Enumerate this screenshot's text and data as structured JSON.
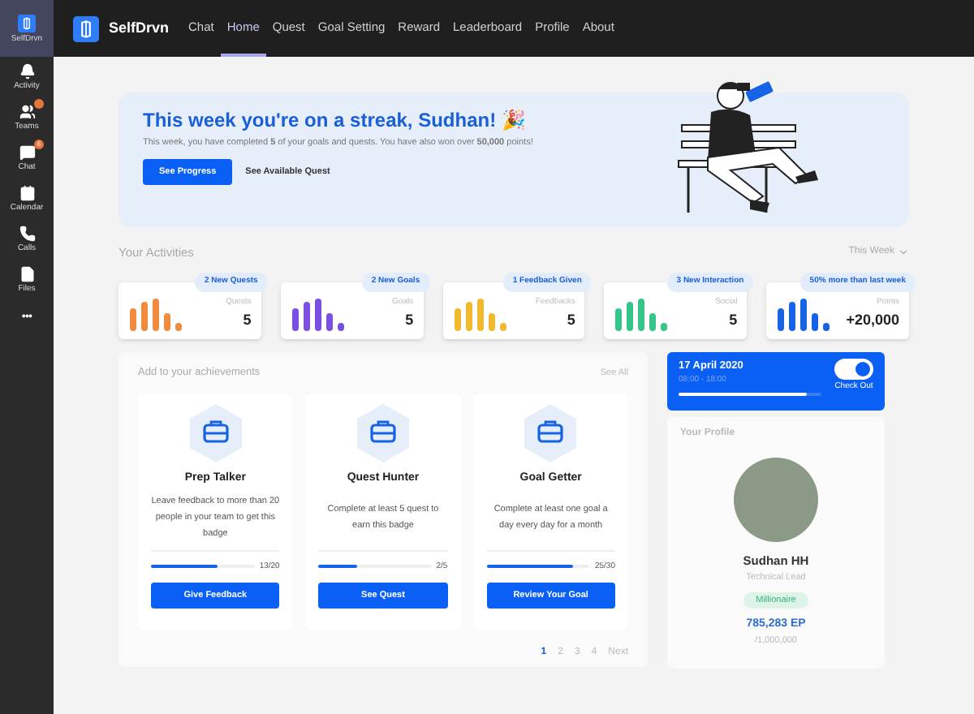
{
  "rail": {
    "items": [
      {
        "label": "SelfDrvn",
        "kind": "app",
        "selected": true
      },
      {
        "label": "Activity",
        "kind": "bell",
        "selected": false
      },
      {
        "label": "Teams",
        "kind": "teams",
        "selected": false,
        "badge": true
      },
      {
        "label": "Chat",
        "kind": "chat",
        "selected": false,
        "badge": true,
        "count": "6"
      },
      {
        "label": "Calendar",
        "kind": "calendar",
        "selected": false
      },
      {
        "label": "Calls",
        "kind": "phone",
        "selected": false
      },
      {
        "label": "Files",
        "kind": "file",
        "selected": false
      }
    ],
    "more": "•••"
  },
  "header": {
    "app_name": "SelfDrvn",
    "tabs": [
      {
        "label": "Chat",
        "selected": false
      },
      {
        "label": "Home",
        "selected": true
      },
      {
        "label": "Quest",
        "selected": false
      },
      {
        "label": "Goal Setting",
        "selected": false
      },
      {
        "label": "Reward",
        "selected": false
      },
      {
        "label": "Leaderboard",
        "selected": false
      },
      {
        "label": "Profile",
        "selected": false
      },
      {
        "label": "About",
        "selected": false
      }
    ]
  },
  "banner": {
    "title": "This week you're on a streak, Sudhan! 🎉",
    "text": "This week, you have completed **5** of your goals and quests. You have also won over **50,000** points!",
    "primary_button": "See Progress",
    "secondary_button": "See Available Quest"
  },
  "activities": {
    "title": "Your Activities",
    "period": "This Week",
    "cards": [
      {
        "tag": "2 New Quests",
        "label": "Quests",
        "value": "5",
        "color": "#f08a3c"
      },
      {
        "tag": "2 New Goals",
        "label": "Goals",
        "value": "5",
        "color": "#7b4fe0"
      },
      {
        "tag": "1 Feedback Given",
        "label": "Feedbacks",
        "value": "5",
        "color": "#f2b92f"
      },
      {
        "tag": "3 New Interaction",
        "label": "Social",
        "value": "5",
        "color": "#35c48a"
      },
      {
        "tag": "50% more than last week",
        "label": "Points",
        "value": "+20,000",
        "color": "#1663e6"
      }
    ]
  },
  "achievements": {
    "title": "Add to your achievements",
    "see_all": "See All",
    "badges": [
      {
        "title": "Prep Talker",
        "text": "Leave feedback to more than 20 people in your team to get this badge",
        "level": 0.65,
        "reading": "13/20",
        "button": "Give Feedback"
      },
      {
        "title": "Quest Hunter",
        "text": "Complete at least 5 quest to earn this badge",
        "level": 0.34,
        "reading": "2/5",
        "button": "See Quest"
      },
      {
        "title": "Goal Getter",
        "text": "Complete at least one goal a day every day for a month",
        "level": 0.83,
        "reading": "25/30",
        "button": "Review Your Goal"
      }
    ],
    "pages": [
      {
        "label": "1",
        "selected": true
      },
      {
        "label": "2",
        "selected": false
      },
      {
        "label": "3",
        "selected": false
      },
      {
        "label": "4",
        "selected": false
      }
    ],
    "next": "Next"
  },
  "checkin": {
    "date": "17 April 2020",
    "hours": "08:00 - 18:00",
    "level": 0.9,
    "on": true,
    "toggle_label": "Check Out"
  },
  "profile": {
    "title": "Your Profile",
    "name": "Sudhan HH",
    "role": "Technical Lead",
    "badge": "Millionaire",
    "points": "785,283 EP",
    "target": "/1,000,000"
  }
}
